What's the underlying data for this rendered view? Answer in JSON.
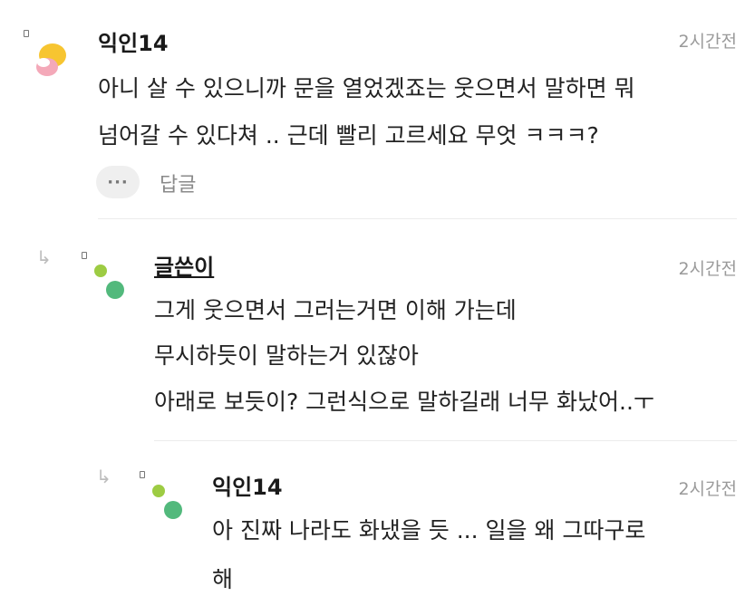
{
  "comments": [
    {
      "username": "익인14",
      "time": "2시간전",
      "lines": [
        "아니 살 수 있으니까 문을 열었겠죠는 웃으면서 말하면 뭐",
        "넘어갈 수 있다쳐 .. 근데 빨리 고르세요 무엇 ㅋㅋㅋ?"
      ],
      "more_icon": "···",
      "reply_label": "답글"
    },
    {
      "username": "글쓴이",
      "time": "2시간전",
      "lines": [
        "그게 웃으면서 그러는거면 이해 가는데",
        "무시하듯이 말하는거 있잖아",
        "아래로 보듯이? 그런식으로 말하길래 너무 화났어..ㅜ"
      ]
    },
    {
      "username": "익인14",
      "time": "2시간전",
      "lines": [
        "아 진짜 나라도 화냈을 듯 ... 일을 왜 그따구로",
        "해"
      ]
    }
  ],
  "icons": {
    "reply_arrow": "↳",
    "avatar_main": "yellow-pink-blob-avatar",
    "avatar_reply": "green-dots-avatar"
  },
  "colors": {
    "avatar_yellow": "#f7c531",
    "avatar_pink": "#f4a9b9",
    "dot_light_green": "#9dcc43",
    "dot_green": "#52b97c"
  }
}
